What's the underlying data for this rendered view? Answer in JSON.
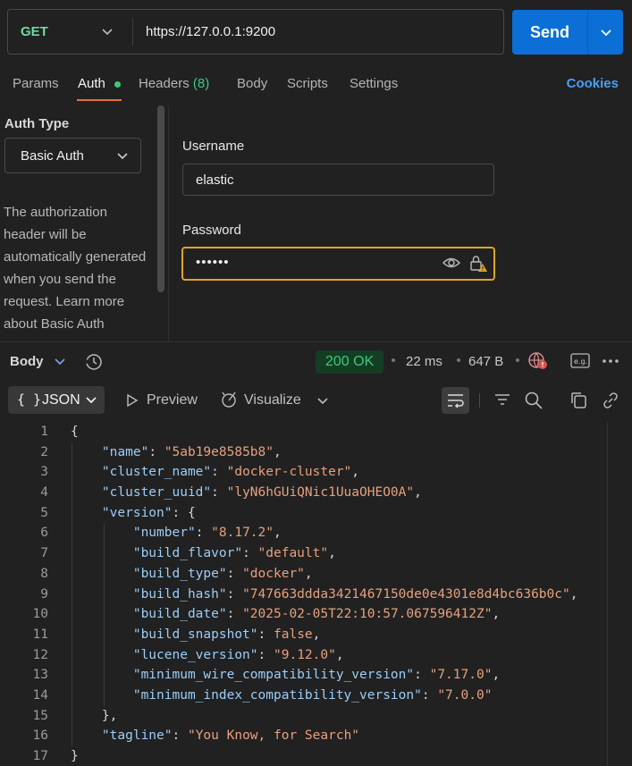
{
  "request": {
    "method": "GET",
    "url": "https://127.0.0.1:9200",
    "send_label": "Send"
  },
  "tabs": {
    "params": "Params",
    "auth": "Auth",
    "headers": "Headers",
    "headers_count": "(8)",
    "body": "Body",
    "scripts": "Scripts",
    "settings": "Settings",
    "cookies": "Cookies"
  },
  "auth": {
    "type_label": "Auth Type",
    "type_value": "Basic Auth",
    "description": "The authorization header will be automatically generated when you send the request. Learn more about Basic Auth",
    "username_label": "Username",
    "username_value": "elastic",
    "password_label": "Password",
    "password_value": "••••••"
  },
  "response": {
    "body_label": "Body",
    "status": "200 OK",
    "time": "22 ms",
    "size": "647 B",
    "eg_label": "e.g."
  },
  "viewer": {
    "format_label": "JSON",
    "brace": "{ }",
    "preview_label": "Preview",
    "visualize_label": "Visualize"
  },
  "code_lines": [
    "{",
    "    \"name\": \"5ab19e8585b8\",",
    "    \"cluster_name\": \"docker-cluster\",",
    "    \"cluster_uuid\": \"lyN6hGUiQNic1UuaOHEO0A\",",
    "    \"version\": {",
    "        \"number\": \"8.17.2\",",
    "        \"build_flavor\": \"default\",",
    "        \"build_type\": \"docker\",",
    "        \"build_hash\": \"747663ddda3421467150de0e4301e8d4bc636b0c\",",
    "        \"build_date\": \"2025-02-05T22:10:57.067596412Z\",",
    "        \"build_snapshot\": false,",
    "        \"lucene_version\": \"9.12.0\",",
    "        \"minimum_wire_compatibility_version\": \"7.17.0\",",
    "        \"minimum_index_compatibility_version\": \"7.0.0\"",
    "    },",
    "    \"tagline\": \"You Know, for Search\"",
    "}"
  ],
  "colors": {
    "accent": "#0b6fd6",
    "method": "#6bdd9a",
    "status_ok": "#3ec978",
    "tab_underline": "#e8703a",
    "password_focus": "#e0a526",
    "json_key": "#9ccdf7",
    "json_string": "#e8a07d"
  }
}
